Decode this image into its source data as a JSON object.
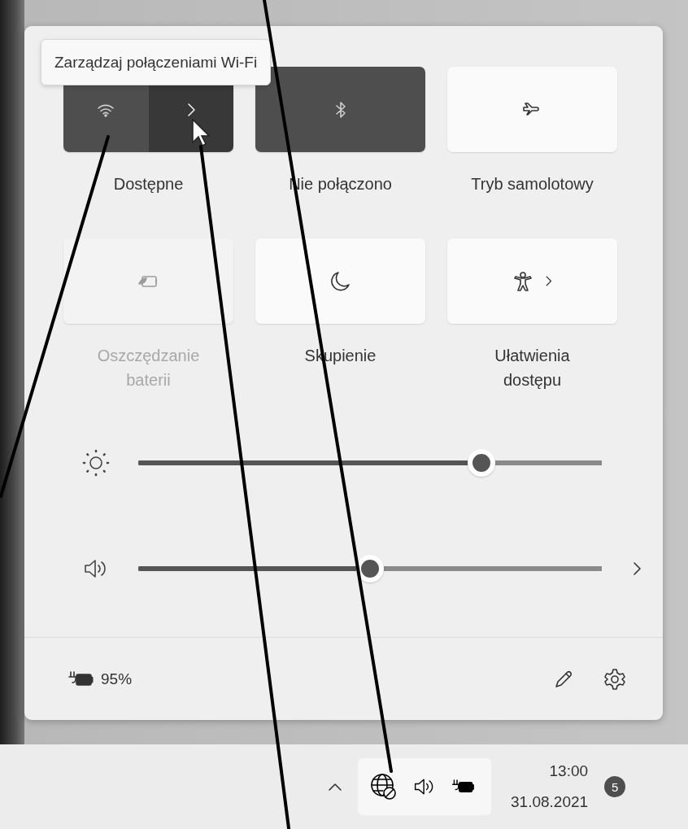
{
  "tooltip": {
    "text": "Zarządzaj połączeniami Wi-Fi"
  },
  "tiles": [
    {
      "kind": "split",
      "label": "Dostępne",
      "on": true,
      "disabled": false
    },
    {
      "kind": "toggle",
      "label": "Nie połączono",
      "on": true,
      "disabled": false
    },
    {
      "kind": "toggle",
      "label": "Tryb samolotowy",
      "on": false,
      "disabled": false
    },
    {
      "kind": "toggle",
      "label": "Oszczędzanie baterii",
      "on": false,
      "disabled": true
    },
    {
      "kind": "toggle",
      "label": "Skupienie",
      "on": false,
      "disabled": false
    },
    {
      "kind": "menu",
      "label": "Ułatwienia dostępu",
      "on": false,
      "disabled": false
    }
  ],
  "sliders": [
    {
      "kind": "brightness",
      "level": 0.74
    },
    {
      "kind": "volume",
      "level": 0.5
    }
  ],
  "footer": {
    "battery": "95%"
  },
  "taskbar": {
    "time": "13:00",
    "date": "31.08.2021",
    "notifications": "5"
  }
}
